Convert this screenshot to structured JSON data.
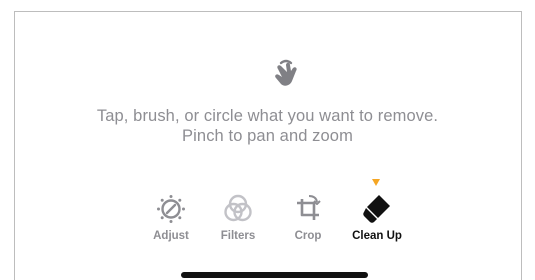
{
  "instructions": {
    "line1": "Tap, brush, or circle what you want to remove.",
    "line2": "Pinch to pan and zoom",
    "icon": "hand-gesture-icon"
  },
  "toolbar": {
    "tools": [
      {
        "label": "Adjust",
        "icon": "adjust-dial-icon",
        "active": false
      },
      {
        "label": "Filters",
        "icon": "filters-circles-icon",
        "active": false
      },
      {
        "label": "Crop",
        "icon": "crop-rotate-icon",
        "active": false
      },
      {
        "label": "Clean Up",
        "icon": "eraser-icon",
        "active": true
      }
    ],
    "active_indicator_color": "#f5a623",
    "inactive_color": "#8e8e93",
    "active_color": "#111111"
  }
}
